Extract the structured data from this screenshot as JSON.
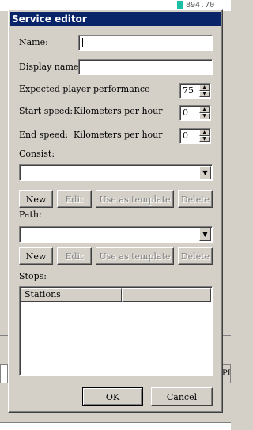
{
  "background": {
    "readout": "894.70",
    "side_button_label": "PL"
  },
  "dialog": {
    "title": "Service editor",
    "name": {
      "label": "Name:",
      "value": ""
    },
    "display_name": {
      "label": "Display name:",
      "value": ""
    },
    "performance": {
      "label": "Expected player performance",
      "value": "75"
    },
    "start_speed": {
      "label": "Start speed:",
      "unit": "Kilometers per hour",
      "value": "0"
    },
    "end_speed": {
      "label": "End speed:",
      "unit": "Kilometers per hour",
      "value": "0"
    },
    "consist": {
      "label": "Consist:",
      "selected": "",
      "buttons": {
        "new": "New",
        "edit": "Edit",
        "template": "Use as template",
        "delete": "Delete"
      }
    },
    "path": {
      "label": "Path:",
      "selected": "",
      "buttons": {
        "new": "New",
        "edit": "Edit",
        "template": "Use as template",
        "delete": "Delete"
      }
    },
    "stops": {
      "label": "Stops:",
      "columns": [
        "Stations",
        ""
      ]
    },
    "ok_label": "OK",
    "cancel_label": "Cancel"
  },
  "colors": {
    "titlebar": "#0a246a",
    "face": "#d4d0c8",
    "readout_chip": "#1cbfa4"
  }
}
